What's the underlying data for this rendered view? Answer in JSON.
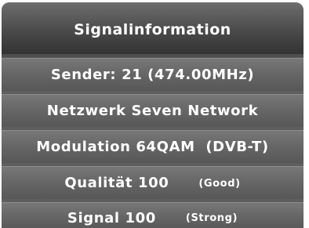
{
  "header": {
    "title": "Signalinformation"
  },
  "rows": {
    "sender": "Sender: 21 (474.00MHz)",
    "network": "Netzwerk Seven Network",
    "modulation": "Modulation 64QAM  (DVB-T)",
    "quality_label": "Qualität 100",
    "quality_status": "(Good)",
    "signal_label": "Signal 100",
    "signal_status": "(Strong)"
  },
  "colors": {
    "panel": "#5e5e5e",
    "text": "#ffffff"
  }
}
